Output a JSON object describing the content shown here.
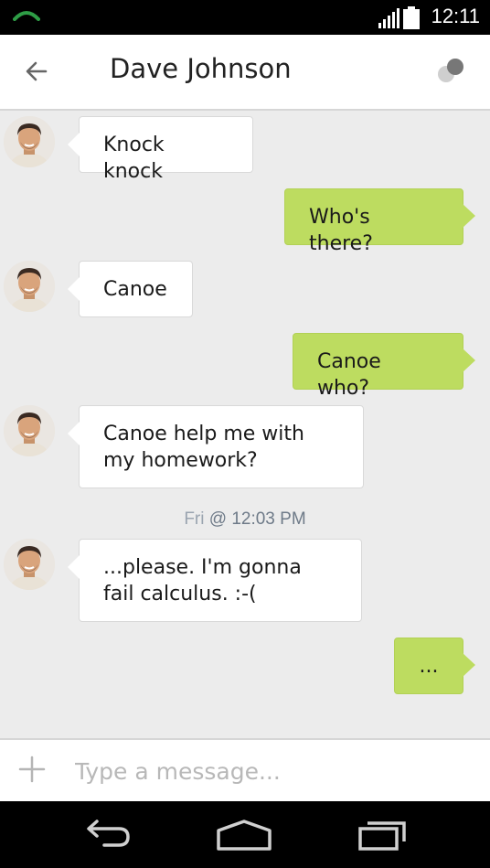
{
  "status_bar": {
    "time": "12:11"
  },
  "app_bar": {
    "title": "Dave Johnson"
  },
  "messages": [
    {
      "direction": "in",
      "text": "Knock knock"
    },
    {
      "direction": "out",
      "text": "Who's there?"
    },
    {
      "direction": "in",
      "text": "Canoe"
    },
    {
      "direction": "out",
      "text": "Canoe who?"
    },
    {
      "direction": "in",
      "text": "Canoe help me with my homework?"
    },
    {
      "direction": "in",
      "text": "...please. I'm gonna fail calculus. :-("
    },
    {
      "direction": "out",
      "text": "..."
    }
  ],
  "timestamp": {
    "day": "Fri",
    "rest": "@ 12:03 PM"
  },
  "composer": {
    "placeholder": "Type a message..."
  },
  "colors": {
    "outgoing_bubble": "#bddc60",
    "background": "#ececec"
  }
}
